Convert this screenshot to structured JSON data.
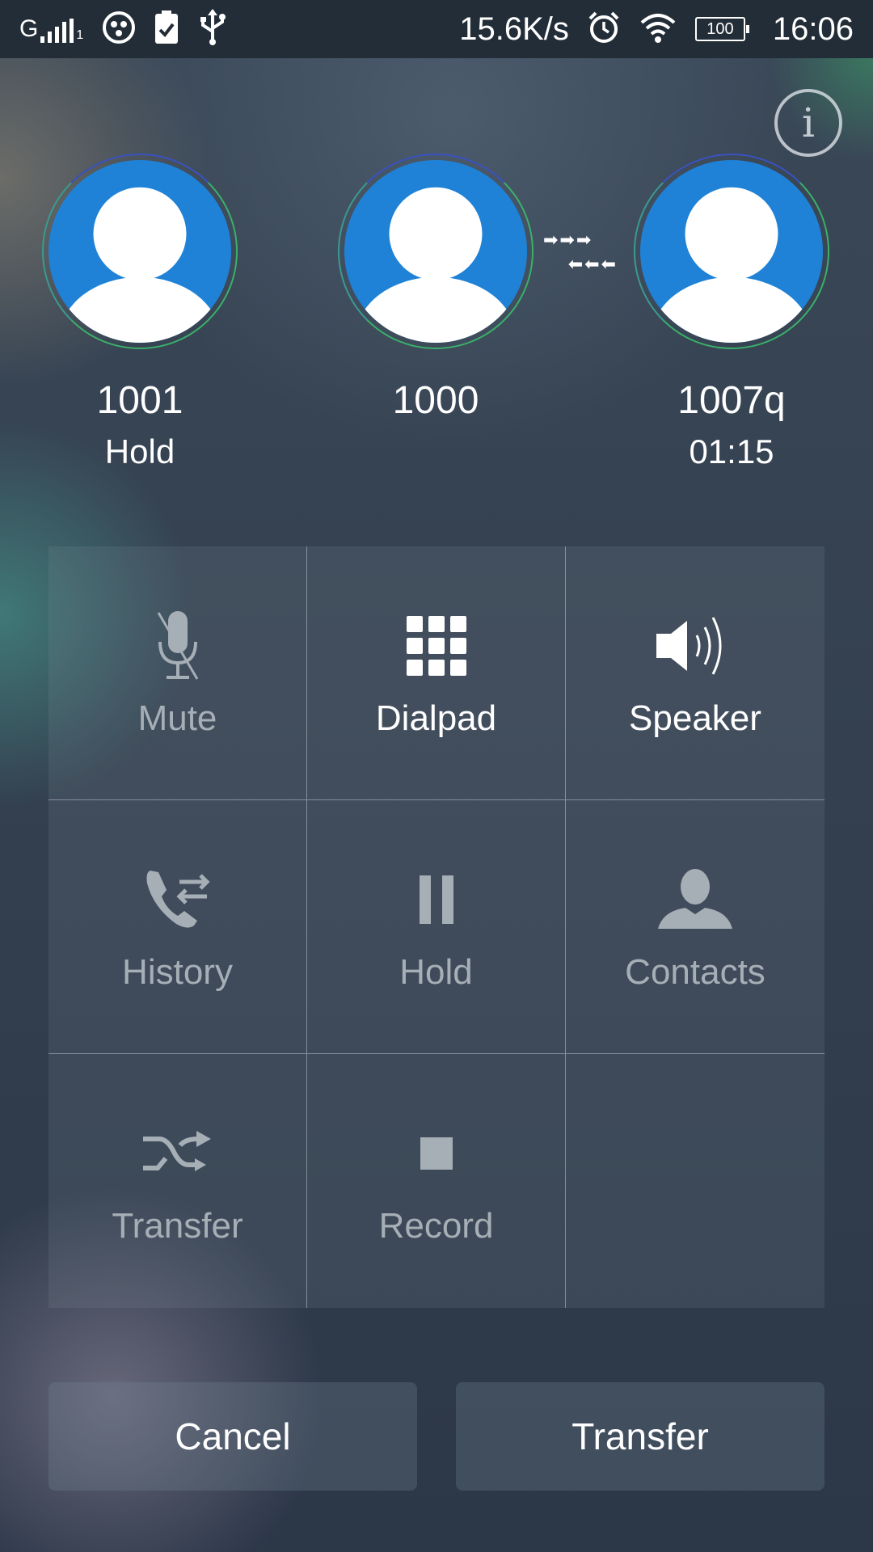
{
  "status_bar": {
    "signal_label": "G",
    "signal_sub": "1",
    "net_speed": "15.6K/s",
    "battery": "100",
    "time": "16:06",
    "icons": [
      "signal-icon",
      "app-icon",
      "clipboard-check-icon",
      "usb-icon",
      "alarm-icon",
      "wifi-icon",
      "battery-icon"
    ]
  },
  "info_button": {
    "glyph": "i"
  },
  "participants": [
    {
      "name": "1001",
      "status": "Hold"
    },
    {
      "name": "1000",
      "status": ""
    },
    {
      "name": "1007q",
      "status": "01:15"
    }
  ],
  "transfer_arrows": {
    "right": "➡➡➡",
    "left": "⬅⬅⬅"
  },
  "actions": [
    {
      "label": "Mute",
      "icon": "microphone-off-icon",
      "enabled": false
    },
    {
      "label": "Dialpad",
      "icon": "dialpad-icon",
      "enabled": true
    },
    {
      "label": "Speaker",
      "icon": "speaker-icon",
      "enabled": true
    },
    {
      "label": "History",
      "icon": "call-history-icon",
      "enabled": false
    },
    {
      "label": "Hold",
      "icon": "pause-icon",
      "enabled": false
    },
    {
      "label": "Contacts",
      "icon": "contact-person-icon",
      "enabled": false
    },
    {
      "label": "Transfer",
      "icon": "transfer-icon",
      "enabled": false
    },
    {
      "label": "Record",
      "icon": "record-stop-icon",
      "enabled": false
    },
    {
      "label": "",
      "icon": "",
      "enabled": false
    }
  ],
  "buttons": {
    "cancel": "Cancel",
    "transfer": "Transfer"
  },
  "colors": {
    "avatar_bg": "#1f82d6",
    "status_bar_bg": "#232d38",
    "dim_text": "#a6aeb6"
  }
}
